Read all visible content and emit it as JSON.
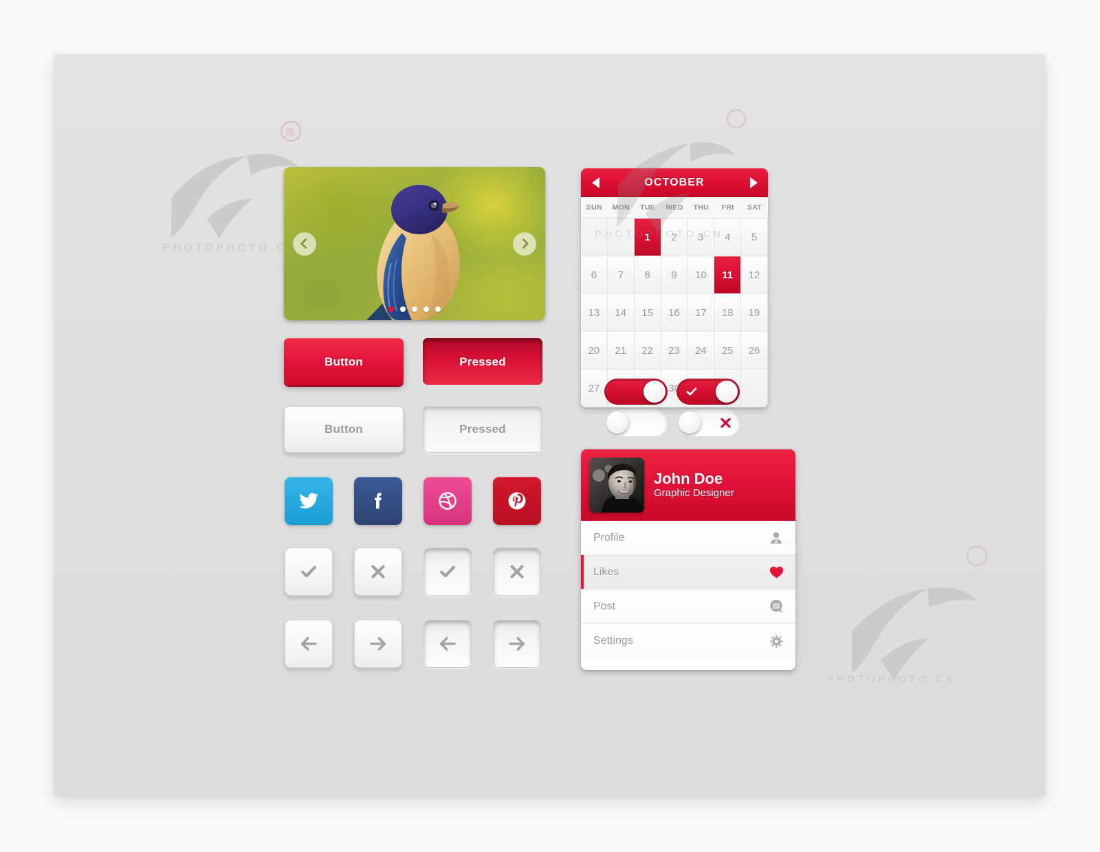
{
  "canvas": {
    "background": "#dedede",
    "page_background": "#fafafa"
  },
  "colors": {
    "accent_red": "#e4143c",
    "red_dark": "#cf0a2c",
    "red_light": "#ee2a45",
    "twitter": "#1b9ed6",
    "facebook": "#3c5a96",
    "dribbble": "#ea4c89",
    "pinterest": "#c8102e",
    "text_gray": "#9a9a9a"
  },
  "slider": {
    "name": "image-carousel",
    "image_subject": "bird illustration on green-yellow bokeh background",
    "prev_label": "‹",
    "next_label": "›",
    "dots_total": 5,
    "dot_active_index": 0
  },
  "buttons": [
    {
      "label": "Button",
      "style": "red",
      "state": "normal"
    },
    {
      "label": "Pressed",
      "style": "red",
      "state": "pressed"
    },
    {
      "label": "Button",
      "style": "white",
      "state": "normal"
    },
    {
      "label": "Pressed",
      "style": "white",
      "state": "pressed"
    }
  ],
  "social_buttons": [
    {
      "name": "twitter",
      "label": "Twitter",
      "icon": "twitter-icon",
      "color": "#1b9ed6"
    },
    {
      "name": "facebook",
      "label": "Facebook",
      "icon": "facebook-icon",
      "color": "#3c5a96"
    },
    {
      "name": "dribbble",
      "label": "Dribbble",
      "icon": "dribbble-icon",
      "color": "#ea4c89"
    },
    {
      "name": "pinterest",
      "label": "Pinterest",
      "icon": "pinterest-icon",
      "color": "#c8102e"
    }
  ],
  "icon_buttons": [
    {
      "icon": "check-icon",
      "label": "Accept",
      "state": "normal"
    },
    {
      "icon": "close-icon",
      "label": "Reject",
      "state": "normal"
    },
    {
      "icon": "check-icon",
      "label": "Accept",
      "state": "pressed"
    },
    {
      "icon": "close-icon",
      "label": "Reject",
      "state": "pressed"
    },
    {
      "icon": "arrow-left-icon",
      "label": "Previous",
      "state": "normal"
    },
    {
      "icon": "arrow-right-icon",
      "label": "Next",
      "state": "normal"
    },
    {
      "icon": "arrow-left-icon",
      "label": "Previous",
      "state": "pressed"
    },
    {
      "icon": "arrow-right-icon",
      "label": "Next",
      "state": "pressed"
    }
  ],
  "calendar": {
    "month": "OCTOBER",
    "prev_label": "Previous month",
    "next_label": "Next month",
    "day_names": [
      "SUN",
      "MON",
      "TUE",
      "WED",
      "THU",
      "FRI",
      "SAT"
    ],
    "lead_blanks": 2,
    "days_in_month": 31,
    "selected_days": [
      1,
      11
    ]
  },
  "toggles": [
    {
      "name": "toggle-on-plain",
      "state": "on",
      "mark": "none"
    },
    {
      "name": "toggle-on-check",
      "state": "on",
      "mark": "check"
    },
    {
      "name": "toggle-off-plain",
      "state": "off",
      "mark": "none"
    },
    {
      "name": "toggle-off-cross",
      "state": "off",
      "mark": "cross"
    }
  ],
  "profile": {
    "name": "John Doe",
    "role": "Graphic Designer",
    "avatar_alt": "grayscale portrait photo of a man",
    "menu": [
      {
        "label": "Profile",
        "icon": "user-icon",
        "active": false
      },
      {
        "label": "Likes",
        "icon": "heart-icon",
        "active": true
      },
      {
        "label": "Post",
        "icon": "comment-icon",
        "active": false
      },
      {
        "label": "Settings",
        "icon": "gear-icon",
        "active": false
      }
    ]
  },
  "watermarks": [
    {
      "text": "PHOTOPHOTO.CN"
    },
    {
      "text": "PHOTOPHOTO.CN"
    },
    {
      "text": "PHOTOPHOTO.CN"
    }
  ]
}
